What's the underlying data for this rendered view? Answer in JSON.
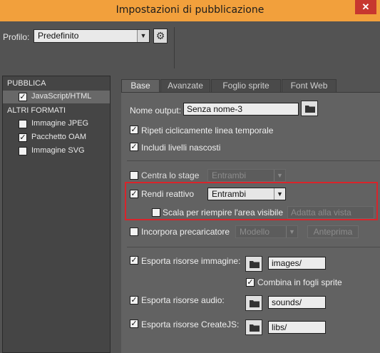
{
  "window": {
    "title": "Impostazioni di pubblicazione",
    "close_glyph": "✕"
  },
  "profile": {
    "label": "Profilo:",
    "value": "Predefinito"
  },
  "sidebar": {
    "group1": "PUBBLICA",
    "group2": "ALTRI FORMATI",
    "items": [
      {
        "label": "JavaScript/HTML",
        "checked": true,
        "selected": true
      },
      {
        "label": "Immagine JPEG",
        "checked": false
      },
      {
        "label": "Pacchetto OAM",
        "checked": true
      },
      {
        "label": "Immagine SVG",
        "checked": false
      }
    ]
  },
  "tabs": [
    "Base",
    "Avanzate",
    "Foglio sprite",
    "Font Web"
  ],
  "form": {
    "output_label": "Nome output:",
    "output_value": "Senza nome-3",
    "loop_label": "Ripeti ciclicamente linea temporale",
    "hidden_layers_label": "Includi livelli nascosti",
    "center_stage_label": "Centra lo stage",
    "center_stage_value": "Entrambi",
    "responsive_label": "Rendi reattivo",
    "responsive_value": "Entrambi",
    "scale_label": "Scala per riempire l'area visibile",
    "scale_value": "Adatta alla vista",
    "preloader_label": "Incorpora precaricatore",
    "preloader_value": "Modello",
    "preview_label": "Anteprima",
    "export_images_label": "Esporta risorse immagine:",
    "images_path": "images/",
    "combine_sprite_label": "Combina in fogli sprite",
    "export_audio_label": "Esporta risorse audio:",
    "sounds_path": "sounds/",
    "export_createjs_label": "Esporta risorse CreateJS:",
    "libs_path": "libs/"
  },
  "colors": {
    "title_bar": "#f2a03c",
    "highlight_box": "#d9242b",
    "close_button": "#c7372f"
  }
}
